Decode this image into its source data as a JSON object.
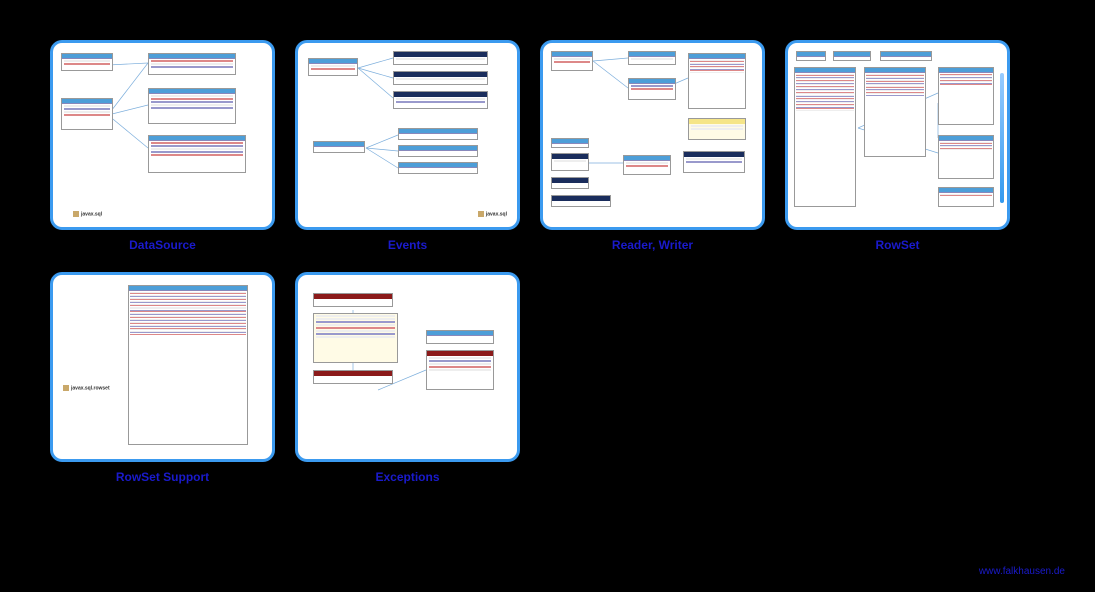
{
  "cards": [
    {
      "label": "DataSource",
      "pkg": "javax.sql"
    },
    {
      "label": "Events",
      "pkg": "javax.sql"
    },
    {
      "label": "Reader, Writer",
      "pkg": ""
    },
    {
      "label": "RowSet",
      "pkg": ""
    },
    {
      "label": "RowSet Support",
      "pkg": "javax.sql.rowset"
    },
    {
      "label": "Exceptions",
      "pkg": ""
    }
  ],
  "footer": "www.falkhausen.de"
}
